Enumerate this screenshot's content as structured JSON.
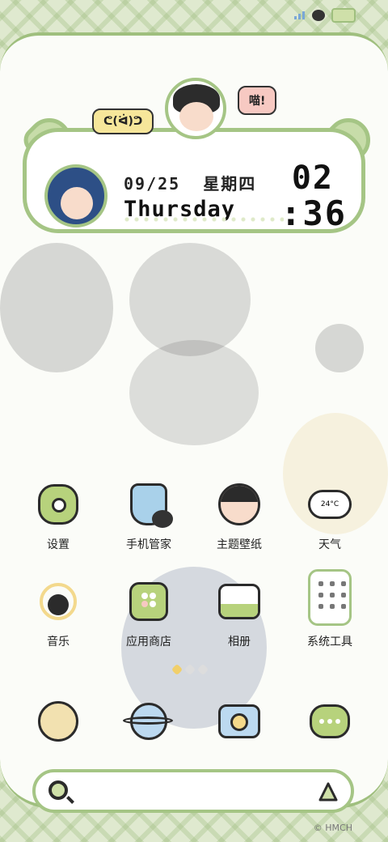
{
  "status_bar": {
    "icons": [
      "signal-icon",
      "cat-icon",
      "battery-icon"
    ]
  },
  "widget": {
    "top_bubble_left": "ᕦ(ᐛ)ᕤ",
    "top_bubble_right": "喵!",
    "date": "09/25",
    "weekday_cn": "星期四",
    "weekday_en": "Thursday",
    "hour": "02",
    "minute": ":36"
  },
  "apps_row1": [
    {
      "label": "设置",
      "icon": "settings-flower-icon"
    },
    {
      "label": "手机管家",
      "icon": "phone-manager-shield-icon"
    },
    {
      "label": "主题壁纸",
      "icon": "theme-wallpaper-icon"
    },
    {
      "label": "天气",
      "icon": "weather-cloud-icon",
      "temp": "24°C"
    }
  ],
  "apps_row2": [
    {
      "label": "音乐",
      "icon": "music-headphones-icon"
    },
    {
      "label": "应用商店",
      "icon": "app-store-icon"
    },
    {
      "label": "相册",
      "icon": "gallery-icon"
    },
    {
      "label": "系统工具",
      "icon": "system-tools-folder-icon"
    }
  ],
  "dock": [
    {
      "icon": "phone-character-icon"
    },
    {
      "icon": "browser-planet-icon"
    },
    {
      "icon": "camera-icon"
    },
    {
      "icon": "messages-chat-icon"
    }
  ],
  "search": {
    "left_icon": "search-icon",
    "right_icon": "assistant-icon"
  },
  "copyright": "© HMCH"
}
